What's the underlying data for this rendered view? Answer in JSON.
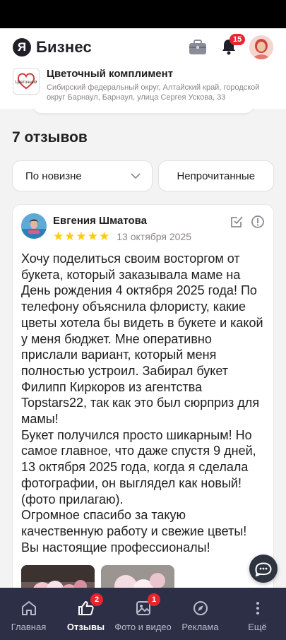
{
  "header": {
    "logo_letter": "Я",
    "logo_text": "Бизнес",
    "notifications_count": "15"
  },
  "organization": {
    "logo_text": "Цветочный",
    "name": "Цветочный комплимент",
    "address": "Сибирский федеральный округ, Алтайский край, городской округ Барнаул, Барнаул, улица Сергея Ускова, 33"
  },
  "reviews": {
    "count_label": "7 отзывов",
    "filters": {
      "sort_label": "По новизне",
      "unread_label": "Непрочитанные"
    },
    "items": [
      {
        "author": "Евгения Шматова",
        "rating": 5,
        "date": "13 октября 2025",
        "text": "Хочу поделиться своим восторгом от букета, который заказывала маме на День рождения 4 октября 2025 года! По телефону объяснила флористу, какие цветы хотела бы видеть в букете и какой у меня бюджет. Мне оперативно прислали вариант, который меня полностью устроил. Забирал букет Филипп Киркоров из агентства Topstars22, так как это был сюрприз для мамы!\nБукет получился просто шикарным! Но самое главное, что даже спустя 9 дней, 13 октября 2025 года, когда я сделала фотографии, он выглядел как новый! (фото прилагаю).\nОгромное спасибо за такую качественную работу и свежие цветы! Вы настоящие профессионалы!"
      }
    ]
  },
  "tabbar": {
    "tabs": [
      {
        "label": "Главная",
        "icon": "home-icon",
        "badge": ""
      },
      {
        "label": "Отзывы",
        "icon": "thumbs-up-icon",
        "badge": "2"
      },
      {
        "label": "Фото и видео",
        "icon": "image-icon",
        "badge": "1"
      },
      {
        "label": "Реклама",
        "icon": "compass-icon",
        "badge": ""
      },
      {
        "label": "Ещё",
        "icon": "more-vertical-icon",
        "badge": ""
      }
    ],
    "active_tab": "Отзывы"
  },
  "colors": {
    "tabbar_bg": "#2c2f45",
    "badge_red": "#e8242c",
    "star_yellow": "#ffcc00"
  }
}
